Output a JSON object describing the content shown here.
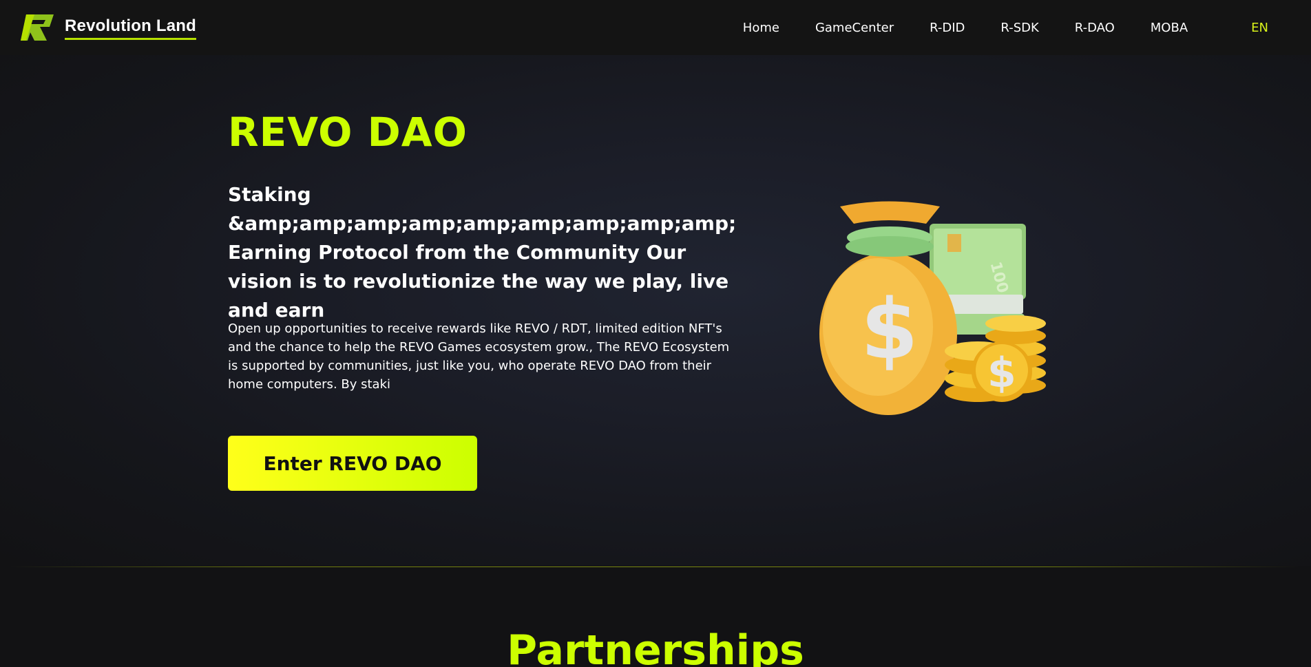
{
  "header": {
    "brand": "Revolution Land",
    "nav": {
      "home": "Home",
      "gamecenter": "GameCenter",
      "rdid": "R-DID",
      "rsdk": "R-SDK",
      "rdao": "R-DAO",
      "moba": "MOBA",
      "lang": "EN"
    }
  },
  "hero": {
    "title": "REVO DAO",
    "subtitle": "Staking &amp;amp;amp;amp;amp;amp;amp;amp;amp; Earning Protocol from the Community Our vision is to revolutionize the way we play, live and earn",
    "description": "Open up opportunities to receive rewards like REVO / RDT, limited edition NFT's and the chance to help the REVO Games ecosystem grow., The REVO Ecosystem is supported by communities, just like you, who operate REVO DAO from their home computers. By staki",
    "cta_label": "Enter REVO DAO"
  },
  "partners": {
    "title": "Partnerships"
  },
  "illustration": {
    "icon": "money-bag-coins-icon",
    "bill_text": "100"
  },
  "colors": {
    "accent": "#ccff00",
    "background": "#121214",
    "lang": "#d9f21a"
  }
}
